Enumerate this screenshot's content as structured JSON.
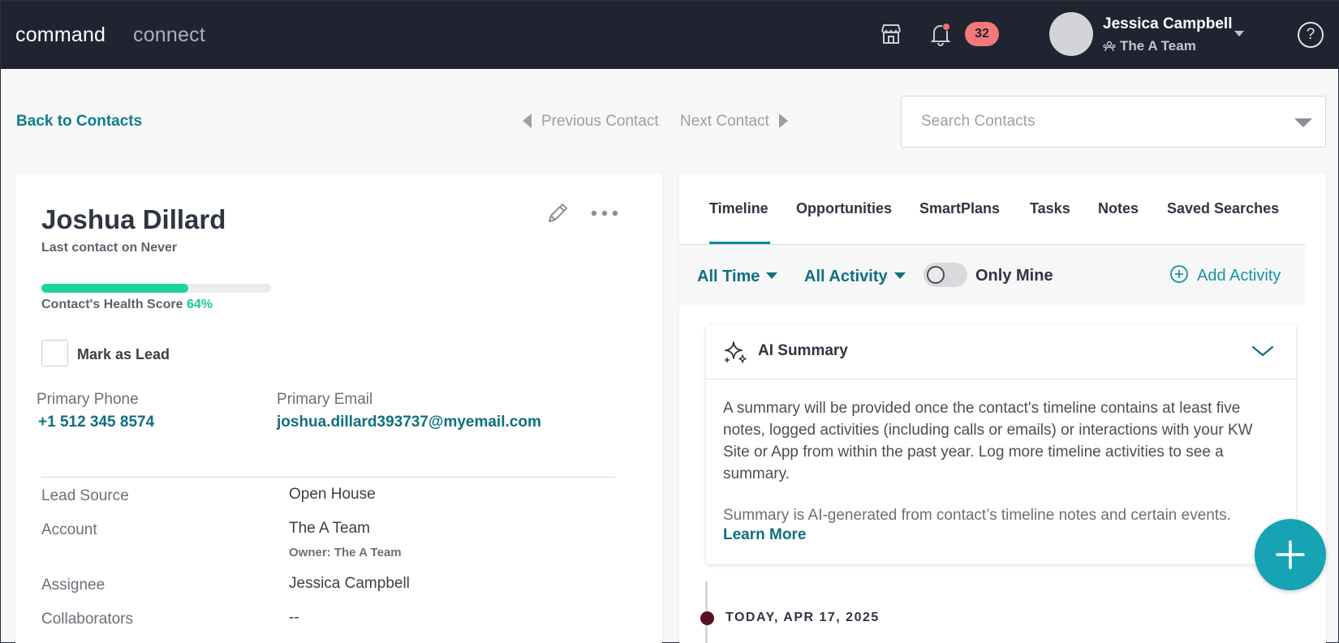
{
  "topbar": {
    "brand_primary": "command",
    "brand_secondary": "connect",
    "notification_count": "32",
    "user_name": "Jessica Campbell",
    "user_team": "The A Team",
    "help_symbol": "?"
  },
  "subheader": {
    "back_label": "Back to Contacts",
    "prev_label": "Previous Contact",
    "next_label": "Next Contact",
    "search_placeholder": "Search Contacts"
  },
  "contact": {
    "name": "Joshua Dillard",
    "last_contact": "Last contact on Never",
    "health_label": "Contact's Health Score",
    "health_value": "64%",
    "health_fraction": 0.64,
    "lead_label": "Mark as Lead",
    "phone_label": "Primary Phone",
    "phone_value": "+1 512 345 8574",
    "email_label": "Primary Email",
    "email_value": "joshua.dillard393737@myemail.com",
    "details": [
      {
        "label": "Lead Source",
        "value": "Open House"
      },
      {
        "label": "Account",
        "value": "The A Team",
        "sub": "Owner: The A Team"
      },
      {
        "label": "Assignee",
        "value": "Jessica Campbell"
      },
      {
        "label": "Collaborators",
        "value": "--"
      }
    ]
  },
  "tabs": [
    "Timeline",
    "Opportunities",
    "SmartPlans",
    "Tasks",
    "Notes",
    "Saved Searches"
  ],
  "filters": {
    "time": "All Time",
    "activity": "All Activity",
    "only_mine": "Only Mine",
    "add_activity": "Add Activity"
  },
  "ai_summary": {
    "title": "AI Summary",
    "body": "A summary will be provided once the contact's timeline contains at least five notes, logged activities (including calls or emails) or interactions with your KW Site or App from within the past year. Log more timeline activities to see a summary.",
    "disclaimer": "Summary is AI-generated from contact’s timeline notes and certain events.",
    "learn_more": "Learn More"
  },
  "timeline": {
    "date_header": "TODAY, APR 17, 2025"
  },
  "colors": {
    "topbar": "#1f2430",
    "accent": "#0f7d8c",
    "health": "#1ad39c",
    "badge": "#f2787a",
    "fab": "#16a4b4"
  }
}
